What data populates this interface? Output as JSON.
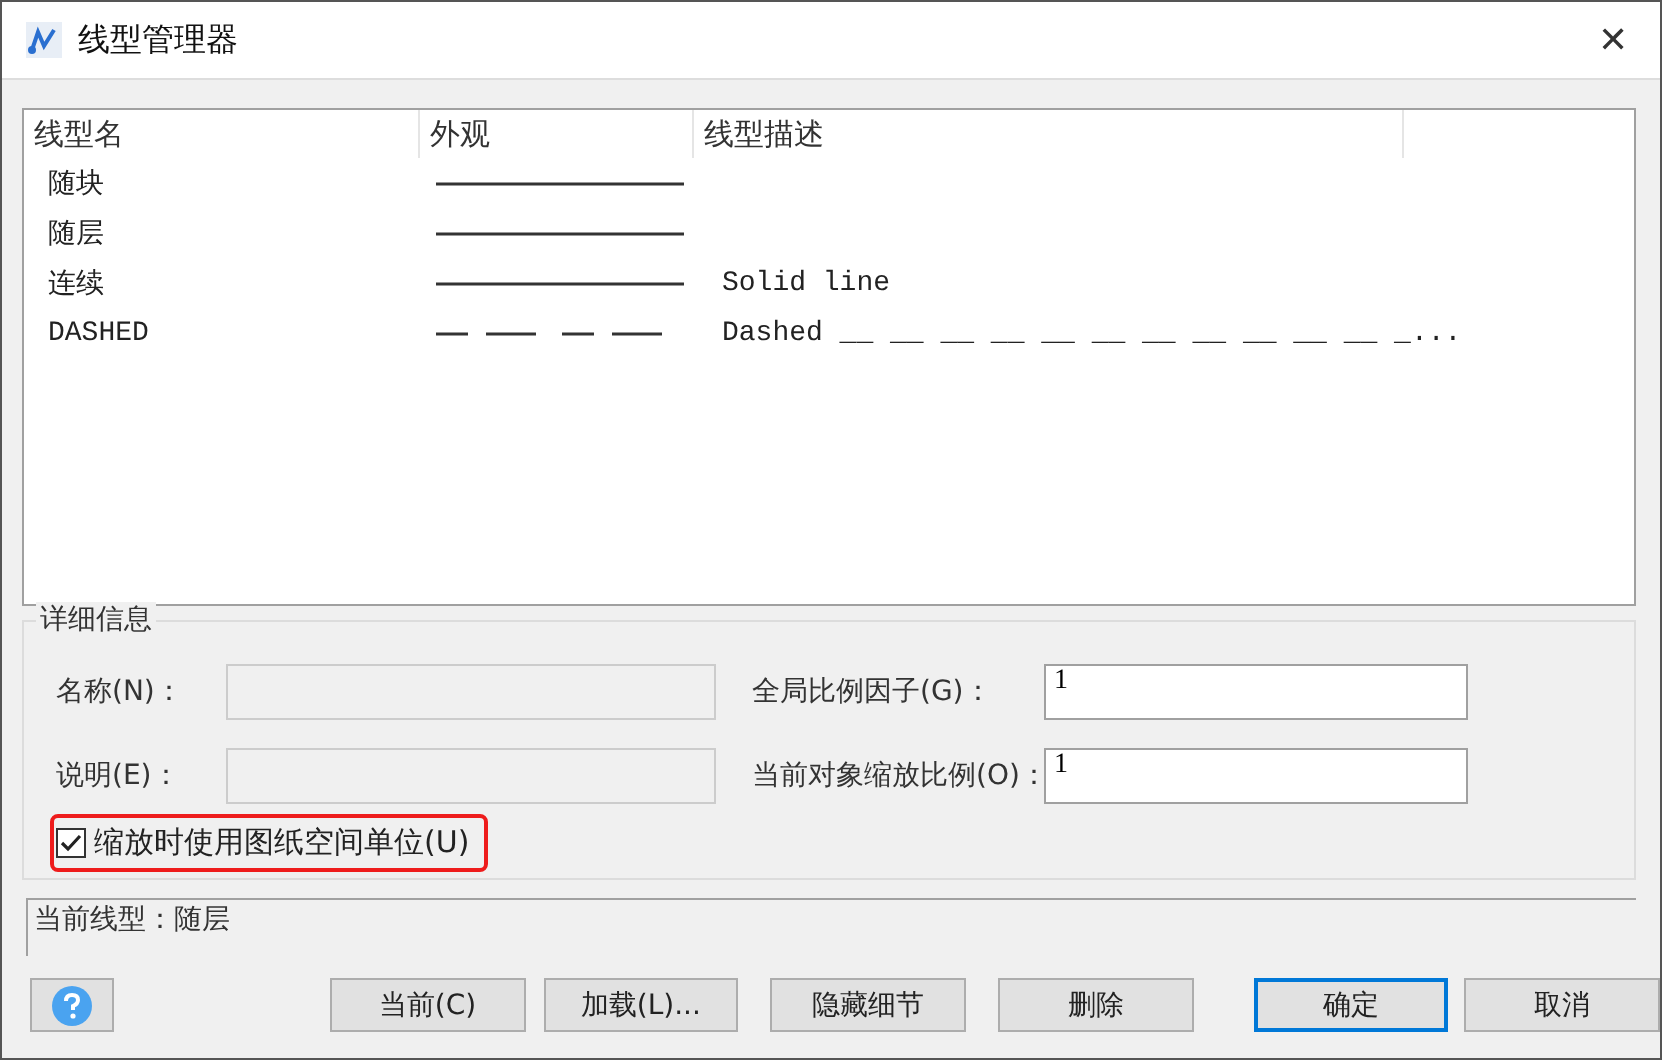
{
  "window": {
    "title": "线型管理器",
    "close": "✕"
  },
  "table": {
    "columns": [
      "线型名",
      "外观",
      "线型描述"
    ],
    "rows": [
      {
        "name": "随块",
        "kind": "solid"
      },
      {
        "name": "随层",
        "kind": "solid"
      },
      {
        "name": "连续",
        "kind": "solid",
        "description": "Solid line"
      },
      {
        "name": "DASHED",
        "kind": "dashed",
        "description": "Dashed __ __ __ __ __ __ __ __ __ __ __ _..."
      }
    ]
  },
  "details": {
    "title": "详细信息",
    "fields": [
      {
        "label": "名称(N)：",
        "disabled": true
      },
      {
        "label": "说明(E)：",
        "disabled": true
      },
      {
        "label": "全局比例因子(G)：",
        "value": "1",
        "disabled": false
      },
      {
        "label": "当前对象缩放比例(O)：",
        "value": "1",
        "disabled": false
      }
    ],
    "checkbox": {
      "label": "缩放时使用图纸空间单位(U)",
      "checked": true,
      "highlighted": true
    }
  },
  "status": "当前线型：随层",
  "buttons": [
    {
      "label": "当前(C)",
      "kind": "normal"
    },
    {
      "label": "加载(L)...",
      "kind": "normal"
    },
    {
      "label": "隐藏细节",
      "kind": "normal"
    },
    {
      "label": "删除",
      "kind": "normal"
    },
    {
      "label": "确定",
      "kind": "default"
    },
    {
      "label": "取消",
      "kind": "normal"
    }
  ]
}
